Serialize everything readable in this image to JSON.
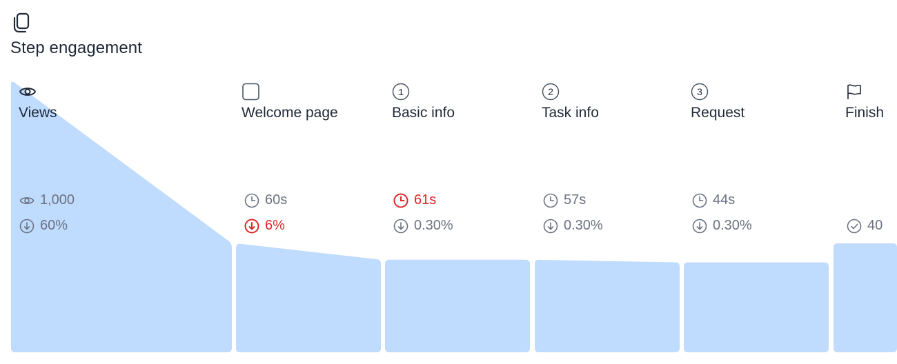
{
  "header": {
    "icon": "copy-icon",
    "title": "Step engagement"
  },
  "colors": {
    "bar_fill": "#bfdbfe",
    "text_primary": "#1f2937",
    "text_muted": "#6b7280",
    "alert": "#dc2626"
  },
  "chart_data": {
    "type": "bar",
    "title": "Step engagement",
    "categories": [
      "Views",
      "Welcome page",
      "Basic info",
      "Task info",
      "Request",
      "Finish"
    ],
    "series": [
      {
        "name": "relative_volume_start",
        "values": [
          1.0,
          0.4,
          0.34,
          0.34,
          0.33,
          0.4
        ]
      },
      {
        "name": "relative_volume_end",
        "values": [
          0.4,
          0.34,
          0.34,
          0.33,
          0.33,
          0.4
        ]
      }
    ],
    "steps": [
      {
        "label": "Views",
        "icon": "eye-icon",
        "views": "1,000",
        "dropoff": "60%",
        "time": null,
        "time_alert": false,
        "dropoff_alert": false
      },
      {
        "label": "Welcome page",
        "icon": "square-icon",
        "time": "60s",
        "dropoff": "6%",
        "time_alert": false,
        "dropoff_alert": true
      },
      {
        "label": "Basic info",
        "icon": "circle-1-icon",
        "time": "61s",
        "dropoff": "0.30%",
        "time_alert": true,
        "dropoff_alert": false
      },
      {
        "label": "Task info",
        "icon": "circle-2-icon",
        "time": "57s",
        "dropoff": "0.30%",
        "time_alert": false,
        "dropoff_alert": false
      },
      {
        "label": "Request",
        "icon": "circle-3-icon",
        "time": "44s",
        "dropoff": "0.30%",
        "time_alert": false,
        "dropoff_alert": false
      },
      {
        "label": "Finish",
        "icon": "flag-icon",
        "completed": "40",
        "time_alert": false,
        "dropoff_alert": false
      }
    ],
    "xlabel": "",
    "ylabel": "",
    "ylim": [
      0,
      1
    ]
  },
  "steps": [
    {
      "label": "Views",
      "number": ""
    },
    {
      "label": "Welcome page",
      "number": ""
    },
    {
      "label": "Basic info",
      "number": "1"
    },
    {
      "label": "Task info",
      "number": "2"
    },
    {
      "label": "Request",
      "number": "3"
    },
    {
      "label": "Finish",
      "number": ""
    }
  ],
  "metrics": {
    "views_count": "1,000",
    "views_dropoff": "60%",
    "welcome_time": "60s",
    "welcome_dropoff": "6%",
    "basic_time": "61s",
    "basic_dropoff": "0.30%",
    "task_time": "57s",
    "task_dropoff": "0.30%",
    "request_time": "44s",
    "request_dropoff": "0.30%",
    "finish_completed": "40"
  }
}
